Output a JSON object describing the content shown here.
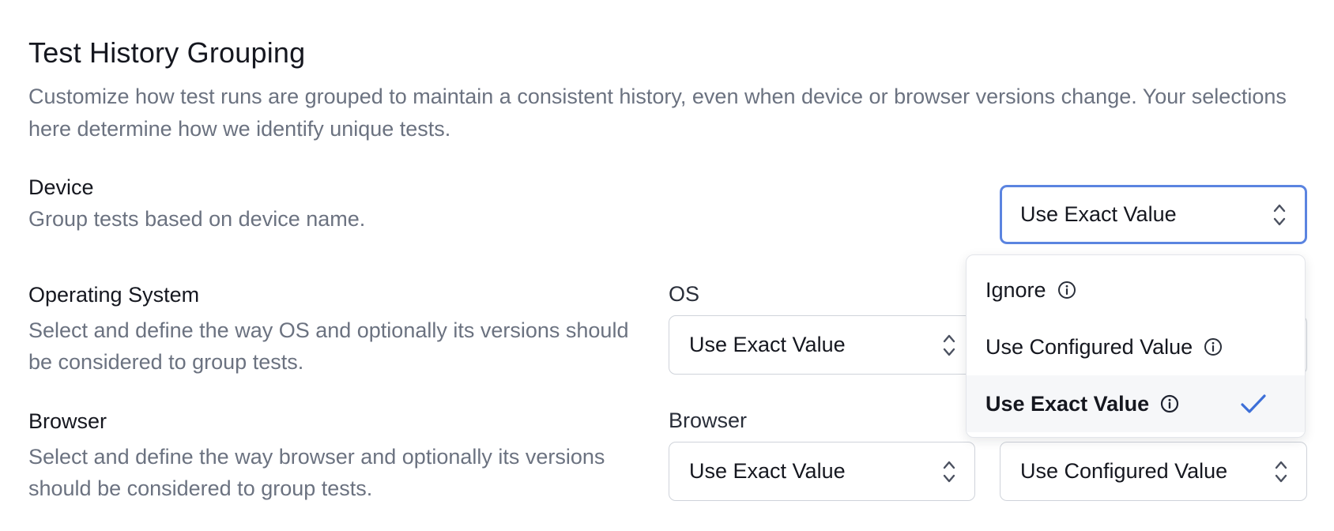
{
  "section": {
    "title": "Test History Grouping",
    "description": "Customize how test runs are grouped to maintain a consistent history, even when device or browser versions change. Your selections here determine how we identify unique tests."
  },
  "device": {
    "label": "Device",
    "help": "Group tests based on device name.",
    "select_value": "Use Exact Value"
  },
  "os": {
    "label": "Operating System",
    "help": "Select and define the way OS and optionally its versions should be considered to group tests.",
    "field_label": "OS",
    "select_value": "Use Exact Value"
  },
  "browser": {
    "label": "Browser",
    "help": "Select and define the way browser and optionally its versions should be considered to group tests.",
    "field_label": "Browser",
    "select_value": "Use Exact Value",
    "version_select_value": "Use Configured Value"
  },
  "dropdown": {
    "options": [
      {
        "label": "Ignore",
        "selected": false
      },
      {
        "label": "Use Configured Value",
        "selected": false
      },
      {
        "label": "Use Exact Value",
        "selected": true
      }
    ],
    "icons": {
      "info": "info-circle-icon",
      "check": "check-icon",
      "chevron": "chevron-up-down-icon"
    },
    "accent_color": "#3d6fd8"
  }
}
